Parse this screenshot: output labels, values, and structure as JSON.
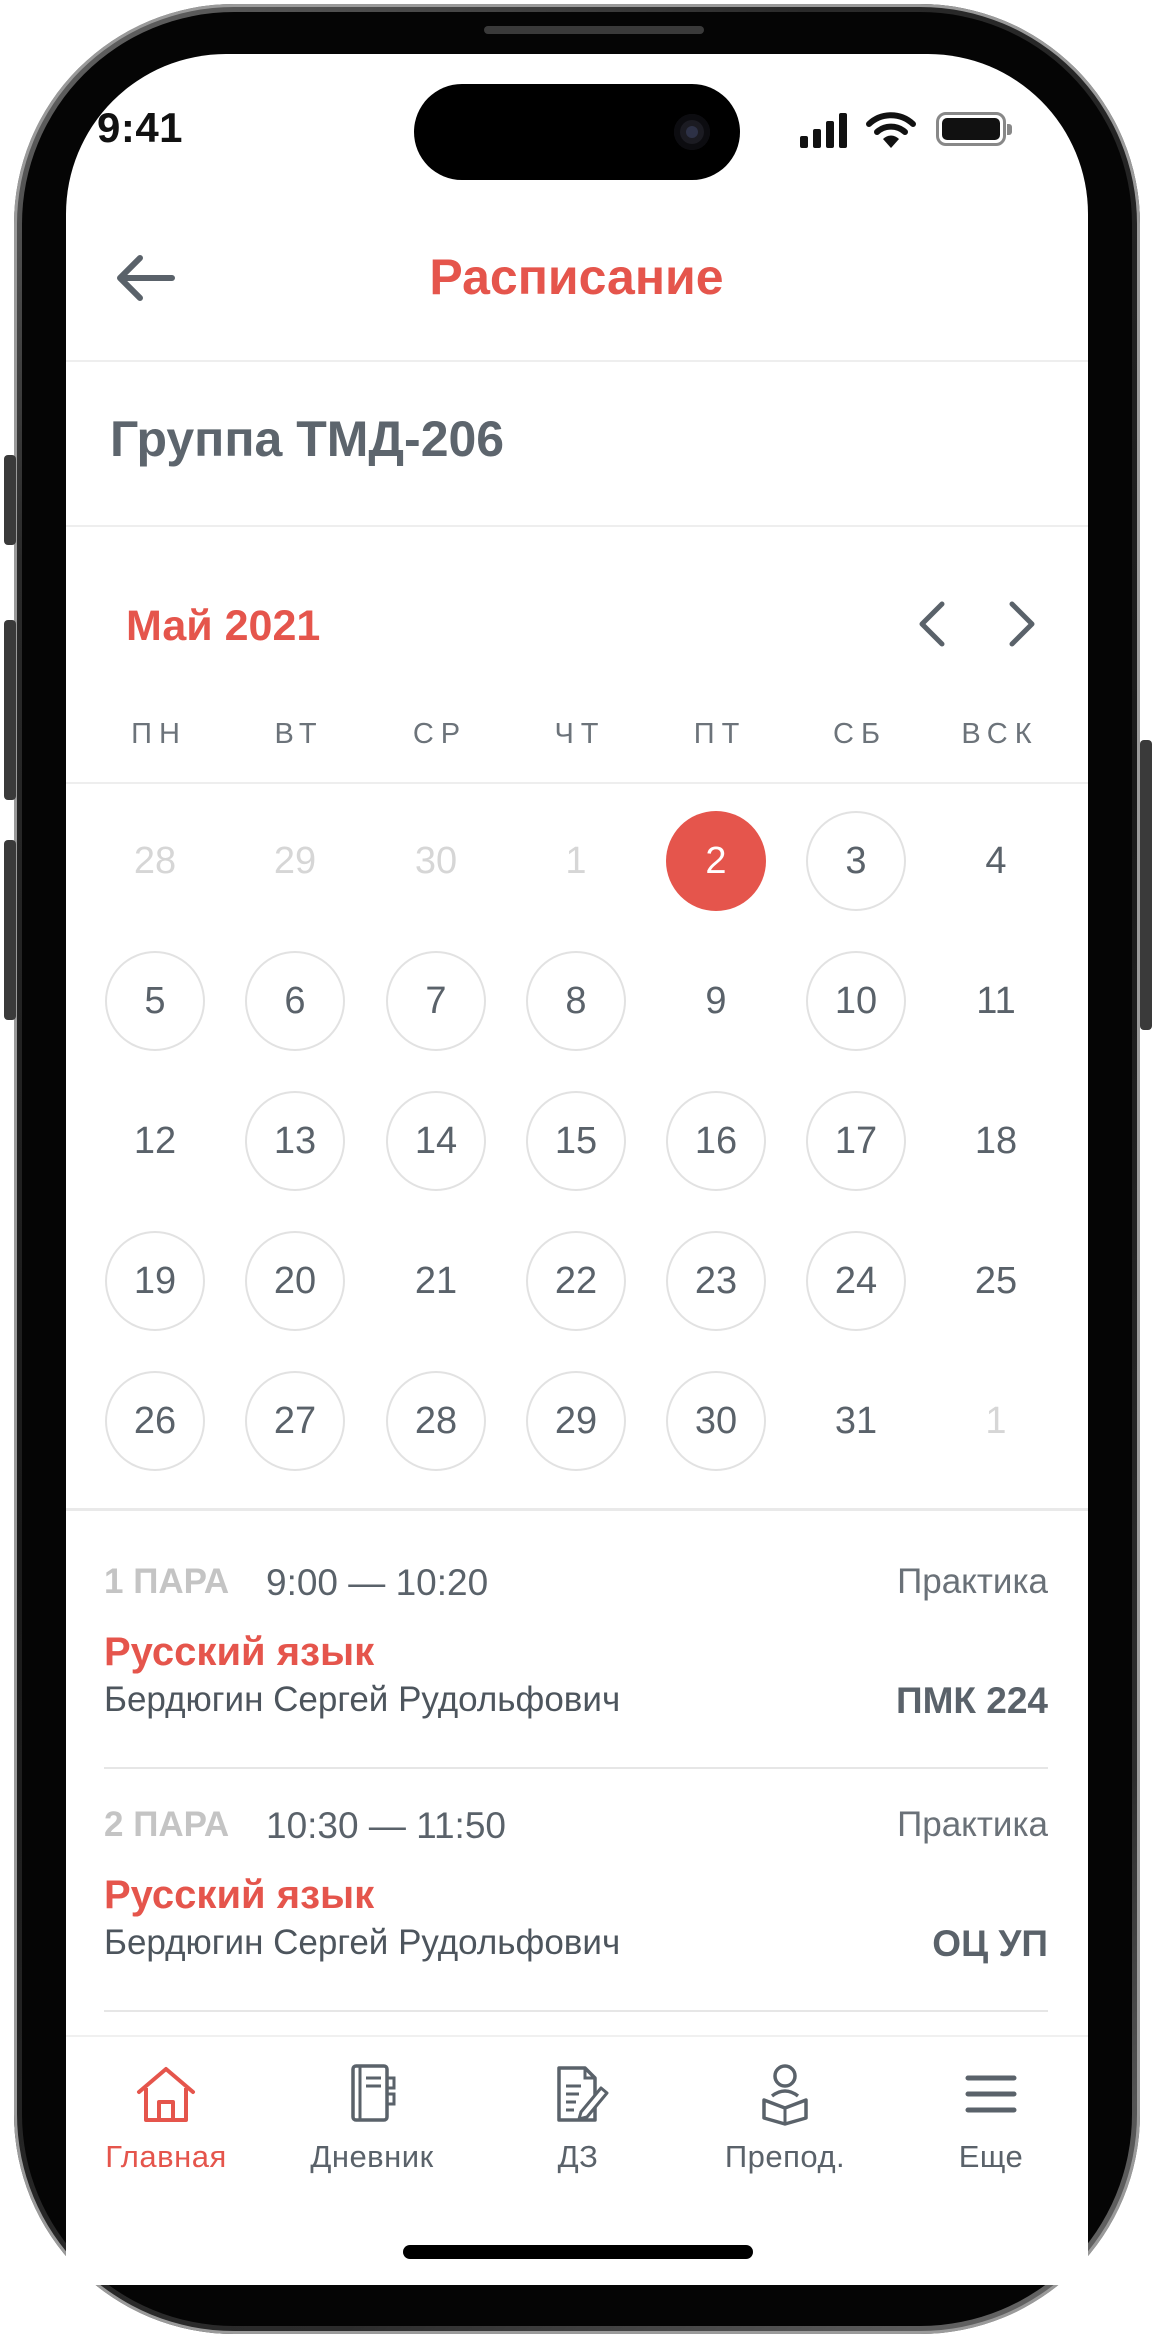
{
  "status_bar": {
    "time": "9:41",
    "icons": [
      "signal-icon",
      "wifi-icon",
      "battery-icon"
    ]
  },
  "header": {
    "title": "Расписание",
    "back_icon": "arrow-left-icon"
  },
  "group": {
    "title": "Группа ТМД-206"
  },
  "calendar": {
    "month_label": "Май 2021",
    "weekdays": [
      "ПН",
      "ВТ",
      "СР",
      "ЧТ",
      "ПТ",
      "СБ",
      "ВСК"
    ],
    "weeks": [
      [
        {
          "d": "28",
          "state": "muted"
        },
        {
          "d": "29",
          "state": "muted"
        },
        {
          "d": "30",
          "state": "muted"
        },
        {
          "d": "1",
          "state": "muted"
        },
        {
          "d": "2",
          "state": "selected"
        },
        {
          "d": "3",
          "state": "ring"
        },
        {
          "d": "4",
          "state": "plain"
        }
      ],
      [
        {
          "d": "5",
          "state": "ring"
        },
        {
          "d": "6",
          "state": "ring"
        },
        {
          "d": "7",
          "state": "ring"
        },
        {
          "d": "8",
          "state": "ring"
        },
        {
          "d": "9",
          "state": "plain"
        },
        {
          "d": "10",
          "state": "ring"
        },
        {
          "d": "11",
          "state": "plain"
        }
      ],
      [
        {
          "d": "12",
          "state": "plain"
        },
        {
          "d": "13",
          "state": "ring"
        },
        {
          "d": "14",
          "state": "ring"
        },
        {
          "d": "15",
          "state": "ring"
        },
        {
          "d": "16",
          "state": "ring"
        },
        {
          "d": "17",
          "state": "ring"
        },
        {
          "d": "18",
          "state": "plain"
        }
      ],
      [
        {
          "d": "19",
          "state": "ring"
        },
        {
          "d": "20",
          "state": "ring"
        },
        {
          "d": "21",
          "state": "plain"
        },
        {
          "d": "22",
          "state": "ring"
        },
        {
          "d": "23",
          "state": "ring"
        },
        {
          "d": "24",
          "state": "ring"
        },
        {
          "d": "25",
          "state": "plain"
        }
      ],
      [
        {
          "d": "26",
          "state": "ring"
        },
        {
          "d": "27",
          "state": "ring"
        },
        {
          "d": "28",
          "state": "ring"
        },
        {
          "d": "29",
          "state": "ring"
        },
        {
          "d": "30",
          "state": "ring"
        },
        {
          "d": "31",
          "state": "plain"
        },
        {
          "d": "1",
          "state": "muted"
        }
      ]
    ]
  },
  "lessons": [
    {
      "number": "1 ПАРА",
      "time": "9:00 — 10:20",
      "type": "Практика",
      "subject": "Русский язык",
      "teacher": "Бердюгин Сергей Рудольфович",
      "room": "ПМК 224"
    },
    {
      "number": "2 ПАРА",
      "time": "10:30 — 11:50",
      "type": "Практика",
      "subject": "Русский язык",
      "teacher": "Бердюгин Сергей Рудольфович",
      "room": "ОЦ УП"
    }
  ],
  "tabbar": {
    "items": [
      {
        "label": "Главная",
        "icon": "home-icon",
        "active": true
      },
      {
        "label": "Дневник",
        "icon": "diary-icon",
        "active": false
      },
      {
        "label": "ДЗ",
        "icon": "homework-icon",
        "active": false
      },
      {
        "label": "Препод.",
        "icon": "teacher-icon",
        "active": false
      },
      {
        "label": "Еще",
        "icon": "menu-icon",
        "active": false
      }
    ]
  },
  "colors": {
    "accent": "#e5554c",
    "text_dark": "#5a626a",
    "muted": "#d6d6d6",
    "ring": "#e2e2e2"
  }
}
